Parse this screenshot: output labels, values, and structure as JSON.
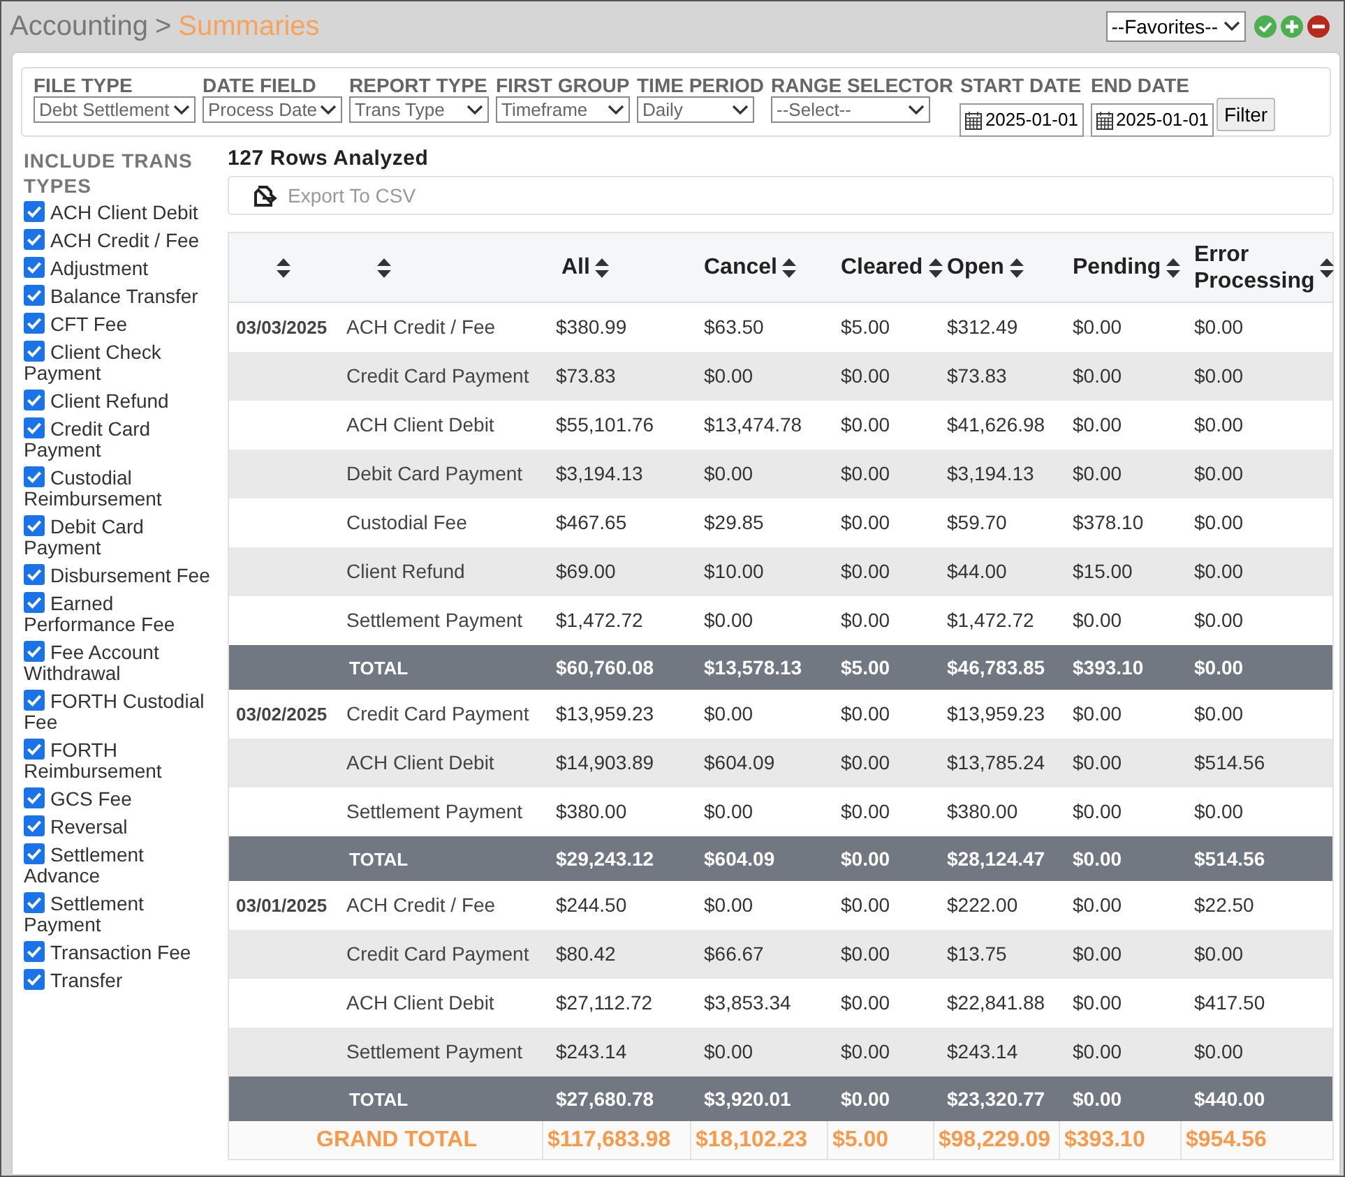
{
  "breadcrumb": {
    "parent": "Accounting",
    "separator": ">",
    "current": "Summaries"
  },
  "favorites": {
    "value": "--Favorites--"
  },
  "filters": [
    {
      "kind": "select",
      "label": "FILE TYPE",
      "value": "Debt Settlement"
    },
    {
      "kind": "select",
      "label": "DATE FIELD",
      "value": "Process Date"
    },
    {
      "kind": "select",
      "label": "REPORT TYPE",
      "value": "Trans Type"
    },
    {
      "kind": "select",
      "label": "FIRST GROUP",
      "value": "Timeframe"
    },
    {
      "kind": "select",
      "label": "TIME PERIOD",
      "value": "Daily"
    },
    {
      "kind": "select",
      "label": "RANGE SELECTOR",
      "value": "--Select--"
    },
    {
      "kind": "date",
      "label": "START DATE",
      "value": "2025-01-01"
    },
    {
      "kind": "date",
      "label": "END DATE",
      "value": "2025-01-01"
    }
  ],
  "filter_button": "Filter",
  "sidebar": {
    "title": "INCLUDE TRANS TYPES",
    "items": [
      {
        "label": "ACH Client Debit",
        "checked": true
      },
      {
        "label": "ACH Credit / Fee",
        "checked": true
      },
      {
        "label": "Adjustment",
        "checked": true
      },
      {
        "label": "Balance Transfer",
        "checked": true
      },
      {
        "label": "CFT Fee",
        "checked": true
      },
      {
        "label": "Client Check Payment",
        "checked": true
      },
      {
        "label": "Client Refund",
        "checked": true
      },
      {
        "label": "Credit Card Payment",
        "checked": true
      },
      {
        "label": "Custodial Reimbursement",
        "checked": true
      },
      {
        "label": "Debit Card Payment",
        "checked": true
      },
      {
        "label": "Disbursement Fee",
        "checked": true
      },
      {
        "label": "Earned Performance Fee",
        "checked": true
      },
      {
        "label": "Fee Account Withdrawal",
        "checked": true
      },
      {
        "label": "FORTH Custodial Fee",
        "checked": true
      },
      {
        "label": "FORTH Reimbursement",
        "checked": true
      },
      {
        "label": "GCS Fee",
        "checked": true
      },
      {
        "label": "Reversal",
        "checked": true
      },
      {
        "label": "Settlement Advance",
        "checked": true
      },
      {
        "label": "Settlement Payment",
        "checked": true
      },
      {
        "label": "Transaction Fee",
        "checked": true
      },
      {
        "label": "Transfer",
        "checked": true
      }
    ]
  },
  "rows_analyzed": "127 Rows Analyzed",
  "export_button": "Export To CSV",
  "table": {
    "columns": [
      "All",
      "Cancel",
      "Cleared",
      "Open",
      "Pending",
      "Error Processing"
    ],
    "groups": [
      {
        "date": "03/03/2025",
        "rows": [
          {
            "type": "ACH Credit / Fee",
            "values": [
              "$380.99",
              "$63.50",
              "$5.00",
              "$312.49",
              "$0.00",
              "$0.00"
            ]
          },
          {
            "type": "Credit Card Payment",
            "values": [
              "$73.83",
              "$0.00",
              "$0.00",
              "$73.83",
              "$0.00",
              "$0.00"
            ]
          },
          {
            "type": "ACH Client Debit",
            "values": [
              "$55,101.76",
              "$13,474.78",
              "$0.00",
              "$41,626.98",
              "$0.00",
              "$0.00"
            ]
          },
          {
            "type": "Debit Card Payment",
            "values": [
              "$3,194.13",
              "$0.00",
              "$0.00",
              "$3,194.13",
              "$0.00",
              "$0.00"
            ]
          },
          {
            "type": "Custodial Fee",
            "values": [
              "$467.65",
              "$29.85",
              "$0.00",
              "$59.70",
              "$378.10",
              "$0.00"
            ]
          },
          {
            "type": "Client Refund",
            "values": [
              "$69.00",
              "$10.00",
              "$0.00",
              "$44.00",
              "$15.00",
              "$0.00"
            ]
          },
          {
            "type": "Settlement Payment",
            "values": [
              "$1,472.72",
              "$0.00",
              "$0.00",
              "$1,472.72",
              "$0.00",
              "$0.00"
            ]
          }
        ],
        "total": {
          "label": "TOTAL",
          "values": [
            "$60,760.08",
            "$13,578.13",
            "$5.00",
            "$46,783.85",
            "$393.10",
            "$0.00"
          ]
        }
      },
      {
        "date": "03/02/2025",
        "rows": [
          {
            "type": "Credit Card Payment",
            "values": [
              "$13,959.23",
              "$0.00",
              "$0.00",
              "$13,959.23",
              "$0.00",
              "$0.00"
            ]
          },
          {
            "type": "ACH Client Debit",
            "values": [
              "$14,903.89",
              "$604.09",
              "$0.00",
              "$13,785.24",
              "$0.00",
              "$514.56"
            ]
          },
          {
            "type": "Settlement Payment",
            "values": [
              "$380.00",
              "$0.00",
              "$0.00",
              "$380.00",
              "$0.00",
              "$0.00"
            ]
          }
        ],
        "total": {
          "label": "TOTAL",
          "values": [
            "$29,243.12",
            "$604.09",
            "$0.00",
            "$28,124.47",
            "$0.00",
            "$514.56"
          ]
        }
      },
      {
        "date": "03/01/2025",
        "rows": [
          {
            "type": "ACH Credit / Fee",
            "values": [
              "$244.50",
              "$0.00",
              "$0.00",
              "$222.00",
              "$0.00",
              "$22.50"
            ]
          },
          {
            "type": "Credit Card Payment",
            "values": [
              "$80.42",
              "$66.67",
              "$0.00",
              "$13.75",
              "$0.00",
              "$0.00"
            ]
          },
          {
            "type": "ACH Client Debit",
            "values": [
              "$27,112.72",
              "$3,853.34",
              "$0.00",
              "$22,841.88",
              "$0.00",
              "$417.50"
            ]
          },
          {
            "type": "Settlement Payment",
            "values": [
              "$243.14",
              "$0.00",
              "$0.00",
              "$243.14",
              "$0.00",
              "$0.00"
            ]
          }
        ],
        "total": {
          "label": "TOTAL",
          "values": [
            "$27,680.78",
            "$3,920.01",
            "$0.00",
            "$23,320.77",
            "$0.00",
            "$440.00"
          ]
        }
      }
    ],
    "grand_total": {
      "label": "GRAND TOTAL",
      "values": [
        "$117,683.98",
        "$18,102.23",
        "$5.00",
        "$98,229.09",
        "$393.10",
        "$954.56"
      ]
    }
  }
}
